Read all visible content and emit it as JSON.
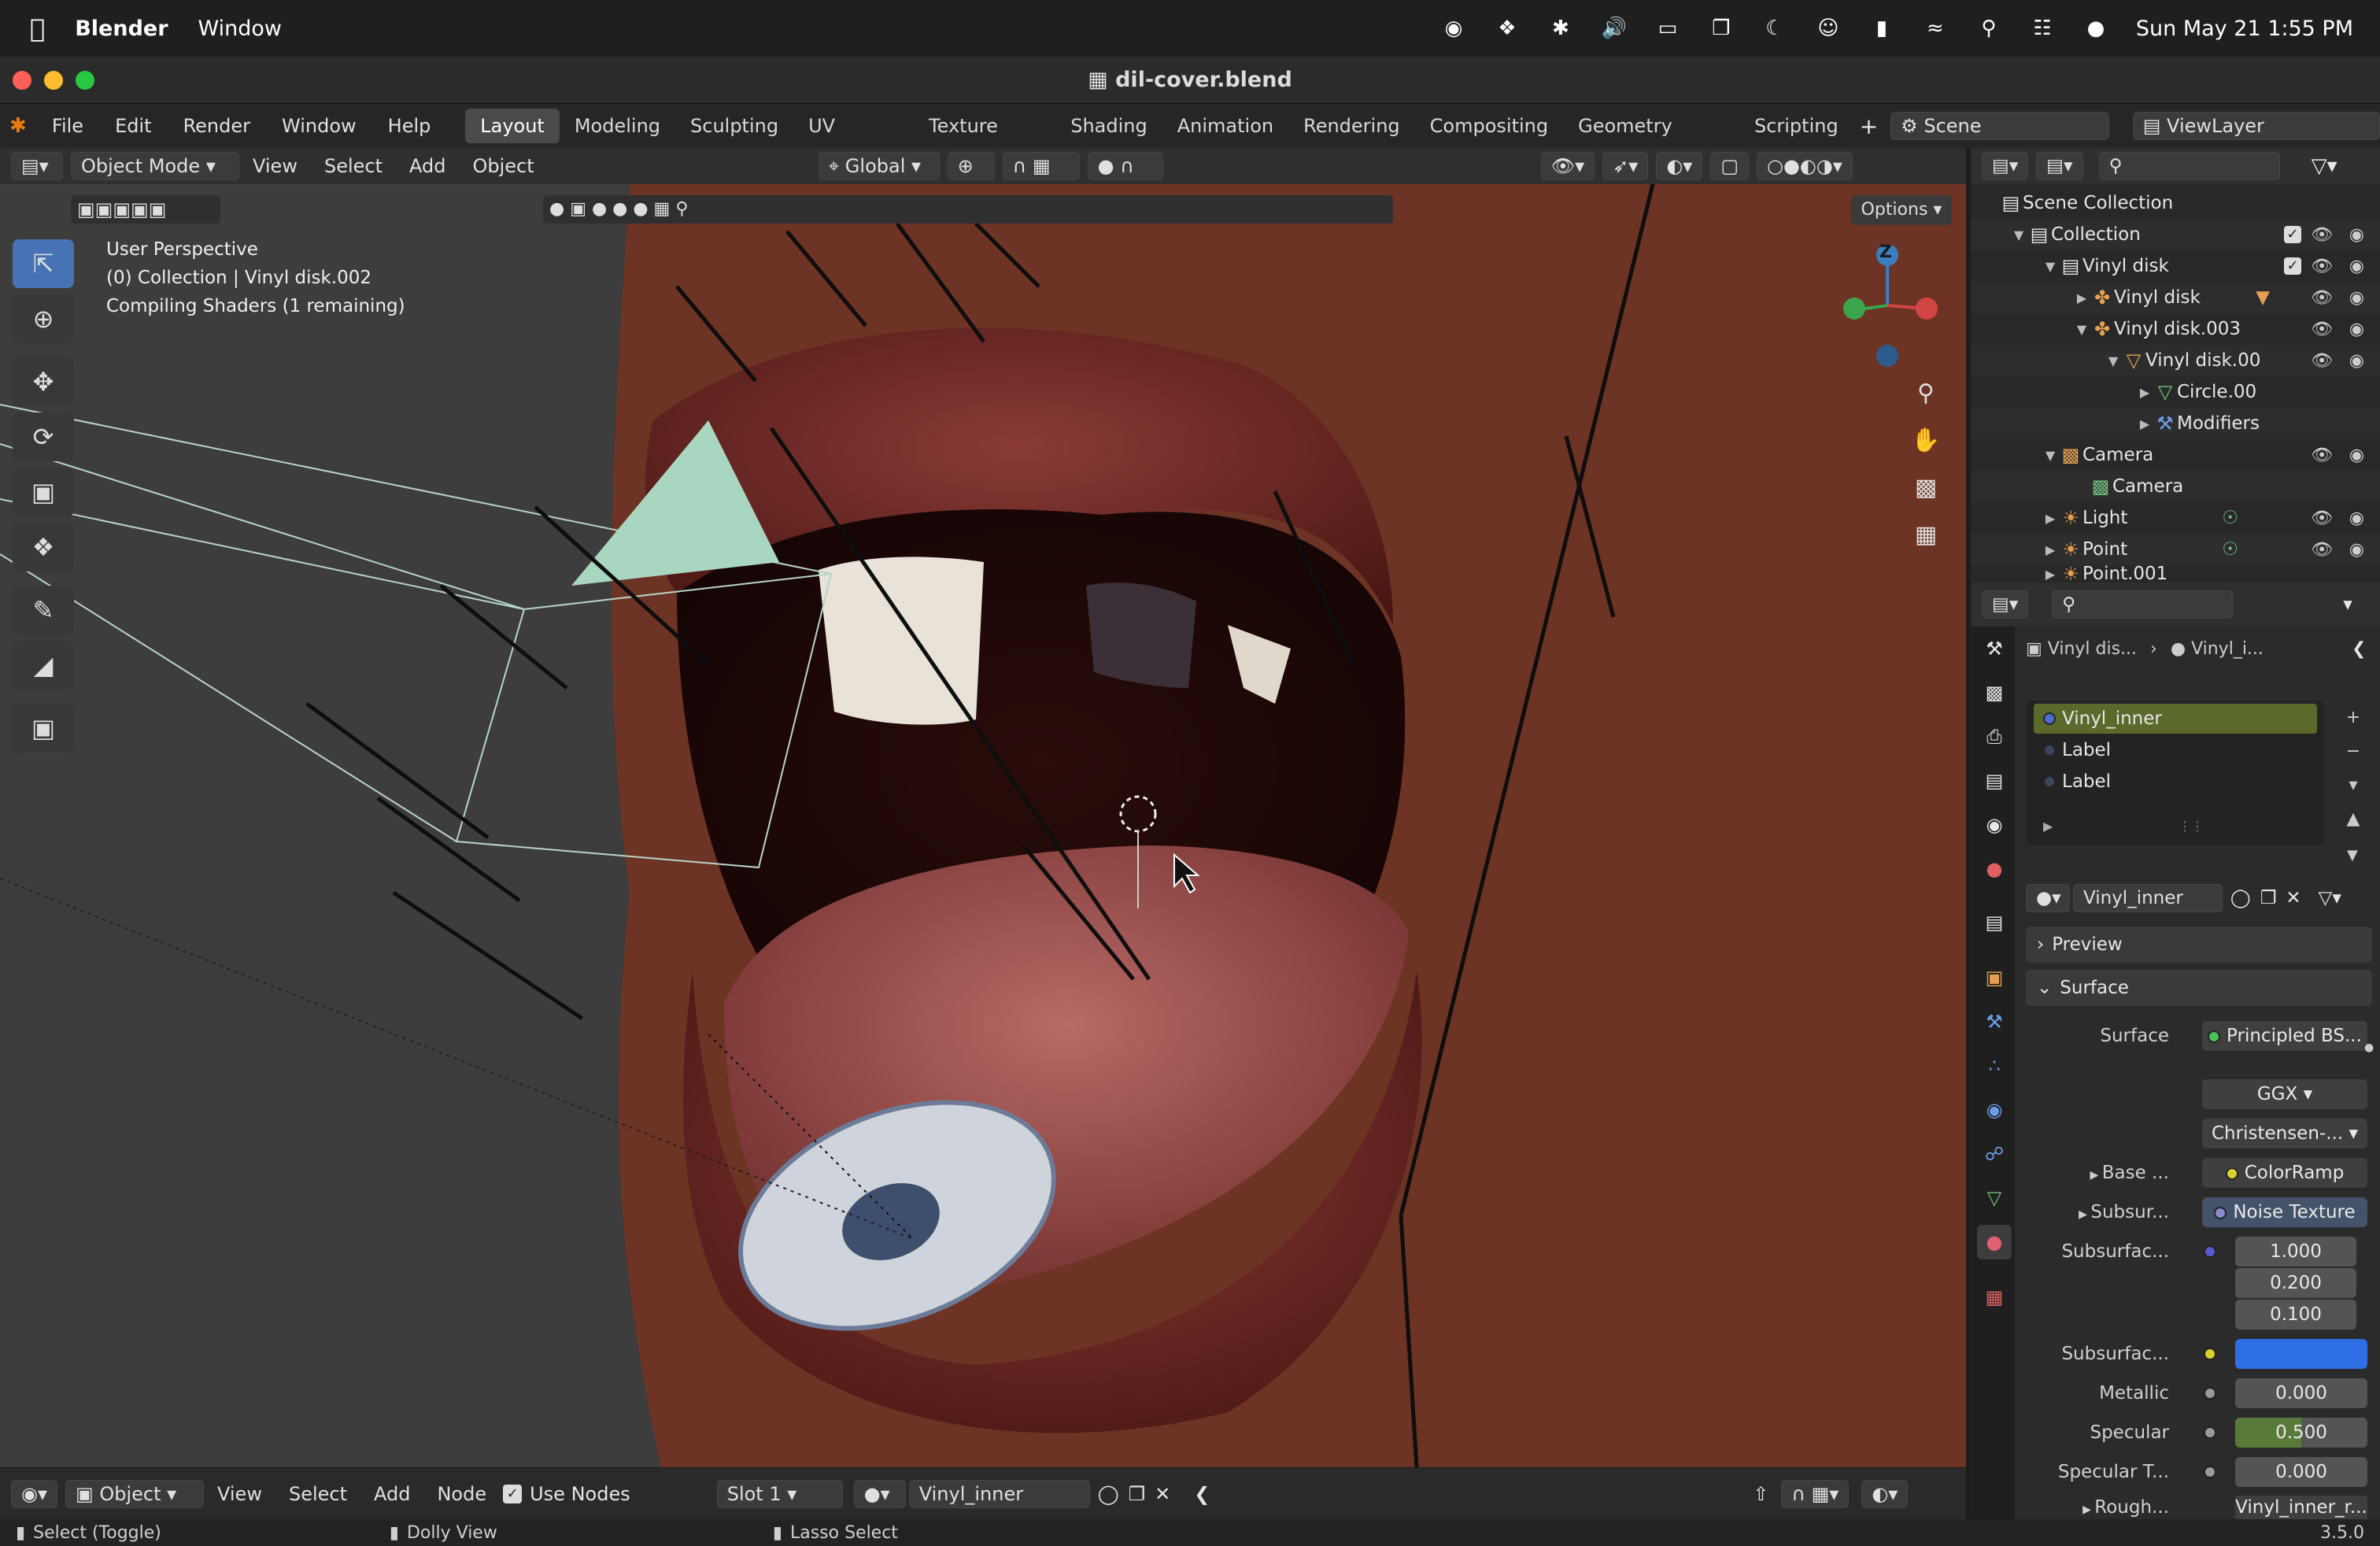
{
  "menubar": {
    "app_name": "Blender",
    "window_menu": "Window",
    "clock": "Sun May 21  1:55 PM"
  },
  "window": {
    "title": "dil-cover.blend"
  },
  "topbar": {
    "menus": [
      "File",
      "Edit",
      "Render",
      "Window",
      "Help"
    ],
    "workspaces": [
      "Layout",
      "Modeling",
      "Sculpting",
      "UV Editing",
      "Texture Paint",
      "Shading",
      "Animation",
      "Rendering",
      "Compositing",
      "Geometry Nodes",
      "Scripting"
    ],
    "active_workspace": "Layout",
    "scene": "Scene",
    "view_layer": "ViewLayer"
  },
  "viewport_header": {
    "mode": "Object Mode",
    "menus": [
      "View",
      "Select",
      "Add",
      "Object"
    ],
    "transform_orientation": "Global",
    "options": "Options"
  },
  "viewport_overlay": {
    "perspective": "User Perspective",
    "collection_info": "(0) Collection | Vinyl disk.002",
    "shader_status": "Compiling Shaders (1 remaining)"
  },
  "gizmo": {
    "z": "Z"
  },
  "outliner": {
    "rows": [
      {
        "label": "Scene Collection"
      },
      {
        "label": "Collection"
      },
      {
        "label": "Vinyl disk"
      },
      {
        "label": "Vinyl disk"
      },
      {
        "label": "Vinyl disk.003"
      },
      {
        "label": "Vinyl disk.00"
      },
      {
        "label": "Circle.00"
      },
      {
        "label": "Modifiers"
      },
      {
        "label": "Camera"
      },
      {
        "label": "Camera"
      },
      {
        "label": "Light"
      },
      {
        "label": "Point"
      },
      {
        "label": "Point.001"
      }
    ]
  },
  "properties": {
    "breadcrumb_object": "Vinyl dis...",
    "breadcrumb_material": "Vinyl_i...",
    "material_slots": [
      "Vinyl_inner",
      "Label",
      "Label"
    ],
    "material_name": "Vinyl_inner",
    "panels": {
      "preview": "Preview",
      "surface": "Surface"
    },
    "surface_label": "Surface",
    "surface_value": "Principled BS...",
    "distribution": "GGX",
    "subsurface_method": "Christensen-...",
    "base_color_label": "Base ...",
    "base_color_value": "ColorRamp",
    "subsurface_label": "Subsur...",
    "subsurface_value": "Noise Texture",
    "subsurface_radius_label": "Subsurfac...",
    "subsurface_radius": [
      "1.000",
      "0.200",
      "0.100"
    ],
    "subsurface_color_label": "Subsurfac...",
    "subsurface_color": "#2f6fe6",
    "metallic_label": "Metallic",
    "metallic": "0.000",
    "specular_label": "Specular",
    "specular": "0.500",
    "specular_tint_label": "Specular T...",
    "specular_tint": "0.000",
    "roughness_label": "Rough...",
    "roughness_value": "Vinyl_inner_r..."
  },
  "node_editor_header": {
    "type": "Object",
    "menus": [
      "View",
      "Select",
      "Add",
      "Node"
    ],
    "use_nodes": "Use Nodes",
    "slot": "Slot 1",
    "material": "Vinyl_inner"
  },
  "statusbar": {
    "left": "Select (Toggle)",
    "middle": "Dolly View",
    "right": "Lasso Select",
    "version": "3.5.0"
  },
  "colors": {
    "accent_blue": "#4772b3",
    "selected_slot": "#5b6a2b",
    "active_workspace": "#4a4a4a"
  }
}
